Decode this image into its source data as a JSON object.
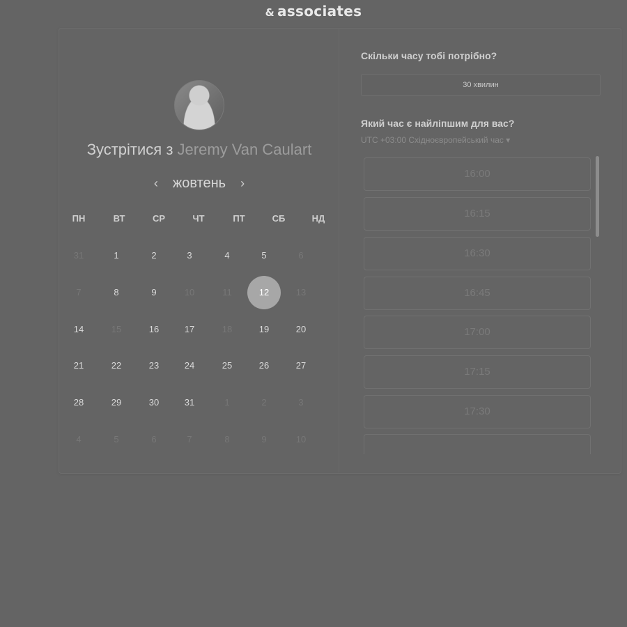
{
  "brand": {
    "amp": "&",
    "name": "associates"
  },
  "booking": {
    "title_prefix": "Зустрітися з",
    "host": "Jeremy Van Caulart",
    "month": "жовтень"
  },
  "calendar": {
    "weekdays": [
      "ПН",
      "ВТ",
      "СР",
      "ЧТ",
      "ПТ",
      "СБ",
      "НД"
    ],
    "weeks": [
      [
        "31",
        "1",
        "2",
        "3",
        "4",
        "5",
        "6"
      ],
      [
        "7",
        "8",
        "9",
        "10",
        "11",
        "12",
        "13"
      ],
      [
        "14",
        "15",
        "16",
        "17",
        "18",
        "19",
        "20"
      ],
      [
        "21",
        "22",
        "23",
        "24",
        "25",
        "26",
        "27"
      ],
      [
        "28",
        "29",
        "30",
        "31",
        "1",
        "2",
        "3"
      ],
      [
        "4",
        "5",
        "6",
        "7",
        "8",
        "9",
        "10"
      ]
    ],
    "muted": [
      [
        true,
        false,
        false,
        false,
        false,
        false,
        true
      ],
      [
        true,
        false,
        false,
        true,
        true,
        false,
        true
      ],
      [
        false,
        true,
        false,
        false,
        true,
        false,
        false
      ],
      [
        false,
        false,
        false,
        false,
        false,
        false,
        false
      ],
      [
        false,
        false,
        false,
        false,
        true,
        true,
        true
      ],
      [
        true,
        true,
        true,
        true,
        true,
        true,
        true
      ]
    ],
    "selected": "12"
  },
  "duration": {
    "question": "Скільки часу тобі потрібно?",
    "value": "30 хвилин"
  },
  "time": {
    "question": "Який час є найліпшим для вас?",
    "timezone": "UTC +03:00 Східноєвропейський час ▾",
    "slots": [
      "16:00",
      "16:15",
      "16:30",
      "16:45",
      "17:00",
      "17:15",
      "17:30",
      ""
    ]
  }
}
